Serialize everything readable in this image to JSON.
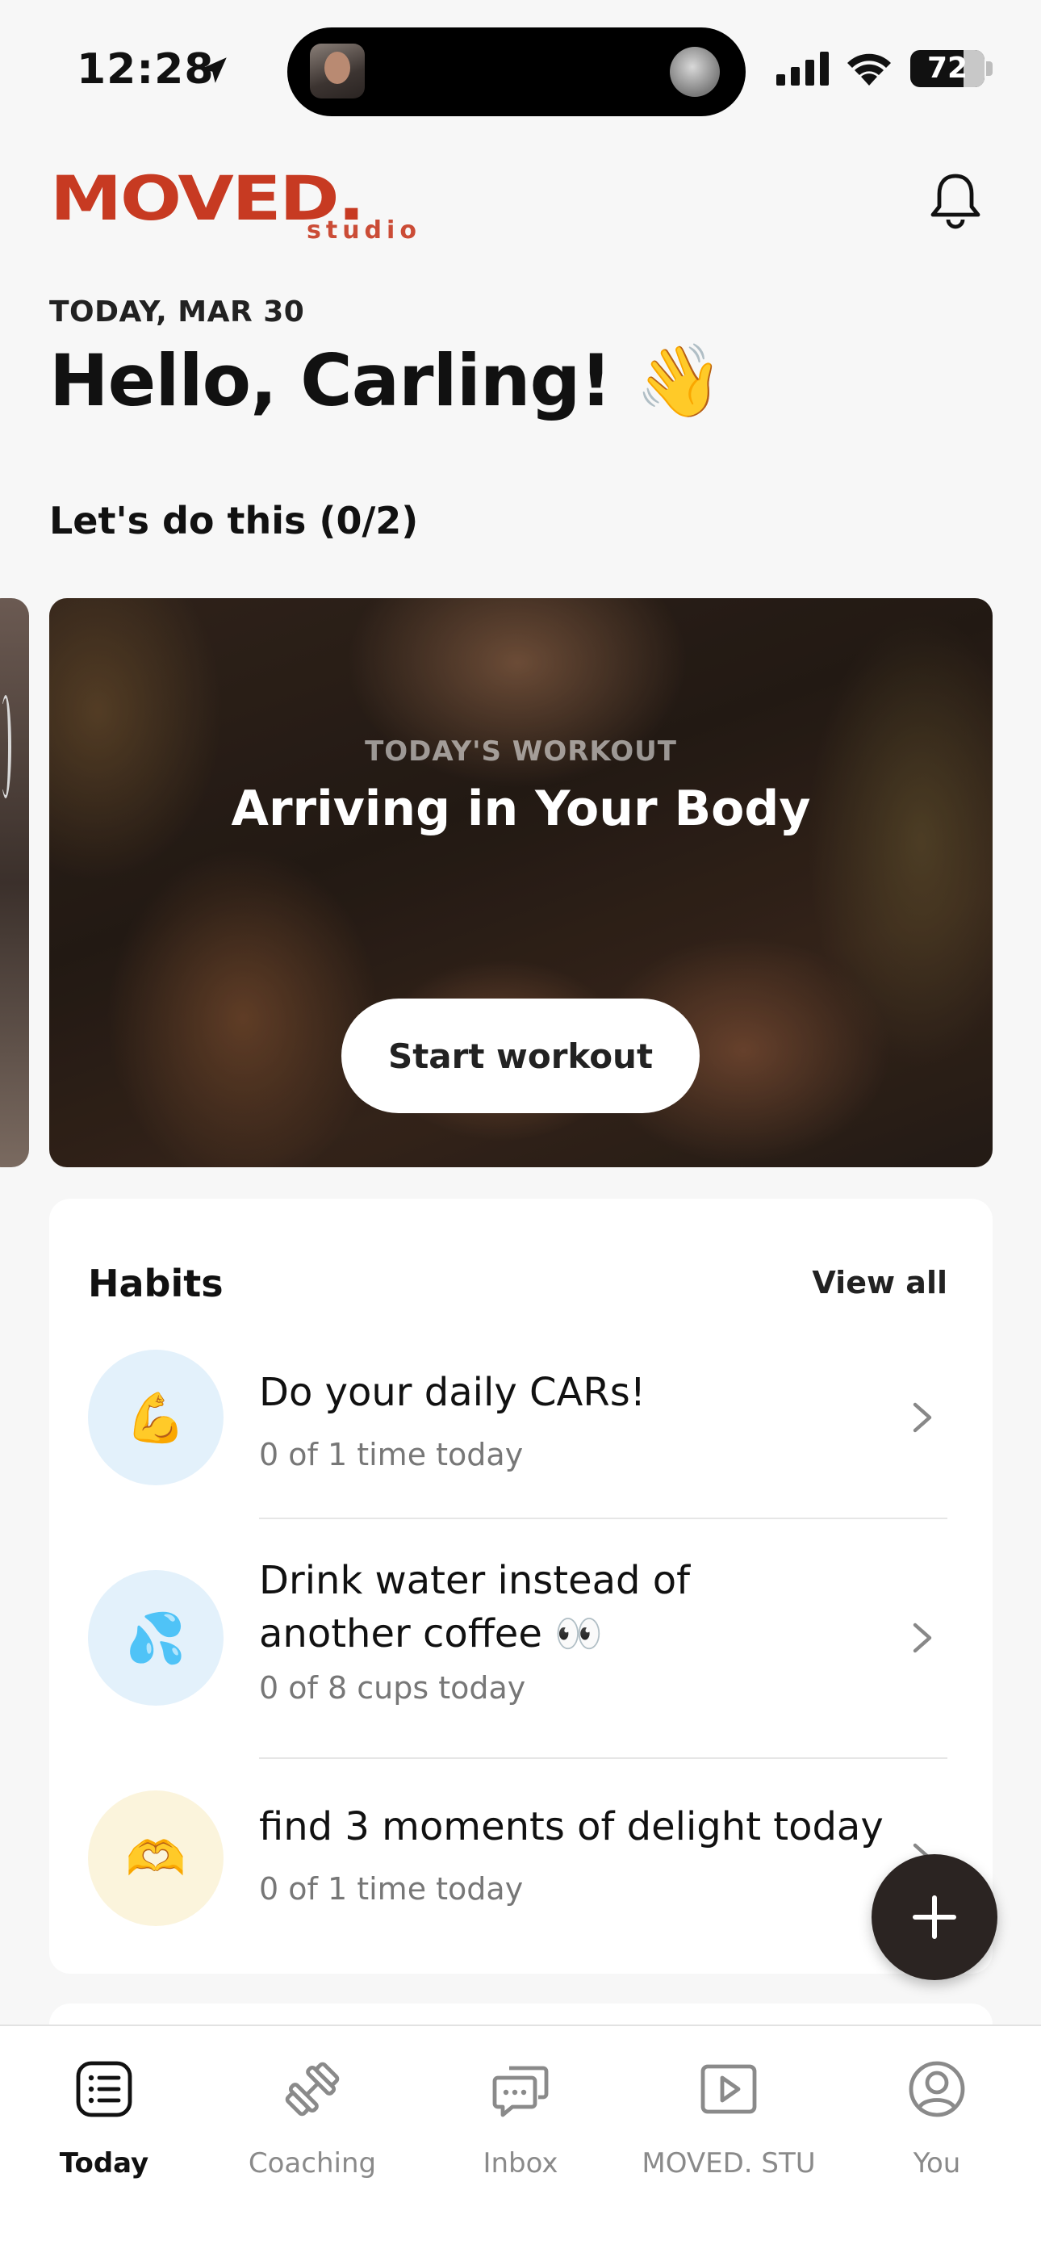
{
  "status_bar": {
    "time": "12:28",
    "battery": "72"
  },
  "header": {
    "logo_main": "MOVED.",
    "logo_sub": "studio"
  },
  "date_label": "TODAY, MAR 30",
  "greeting": "Hello, Carling! 👋",
  "section_title": "Let's do this (0/2)",
  "workout": {
    "eyebrow": "TODAY'S WORKOUT",
    "title": "Arriving in Your Body",
    "button_label": "Start workout"
  },
  "habits": {
    "title": "Habits",
    "view_all": "View all",
    "items": [
      {
        "icon": "💪",
        "name": "Do your daily CARs!",
        "progress": "0 of 1 time today",
        "bg": "#e3f1fb"
      },
      {
        "icon": "💦",
        "name": "Drink water instead of another coffee  👀",
        "progress": "0 of 8 cups today",
        "bg": "#e3f1fb"
      },
      {
        "icon": "🫶",
        "name": "find 3 moments of delight today",
        "progress": "0 of 1 time today",
        "bg": "#fbf4dc"
      }
    ]
  },
  "tabs": [
    {
      "label": "Today",
      "icon": "list-icon",
      "active": true
    },
    {
      "label": "Coaching",
      "icon": "dumbbell-icon",
      "active": false
    },
    {
      "label": "Inbox",
      "icon": "chat-icon",
      "active": false
    },
    {
      "label": "MOVED. STU",
      "icon": "play-icon",
      "active": false
    },
    {
      "label": "You",
      "icon": "profile-icon",
      "active": false
    }
  ],
  "colors": {
    "brand": "#c73a22",
    "fab": "#2b2422"
  }
}
